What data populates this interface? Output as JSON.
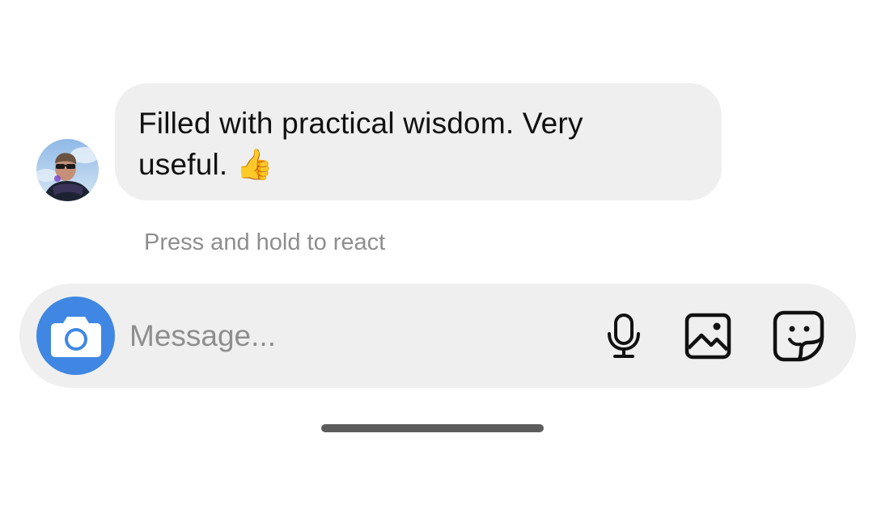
{
  "conversation": {
    "message": {
      "text": "Filled with practical wisdom. Very\nuseful. 👍",
      "sender_avatar": "profile-photo"
    },
    "hint": "Press and hold to react"
  },
  "composer": {
    "placeholder": "Message...",
    "camera_icon": "camera-icon",
    "mic_icon": "microphone-icon",
    "gallery_icon": "image-icon",
    "sticker_icon": "sticker-icon",
    "camera_color": "#3f87e3"
  }
}
